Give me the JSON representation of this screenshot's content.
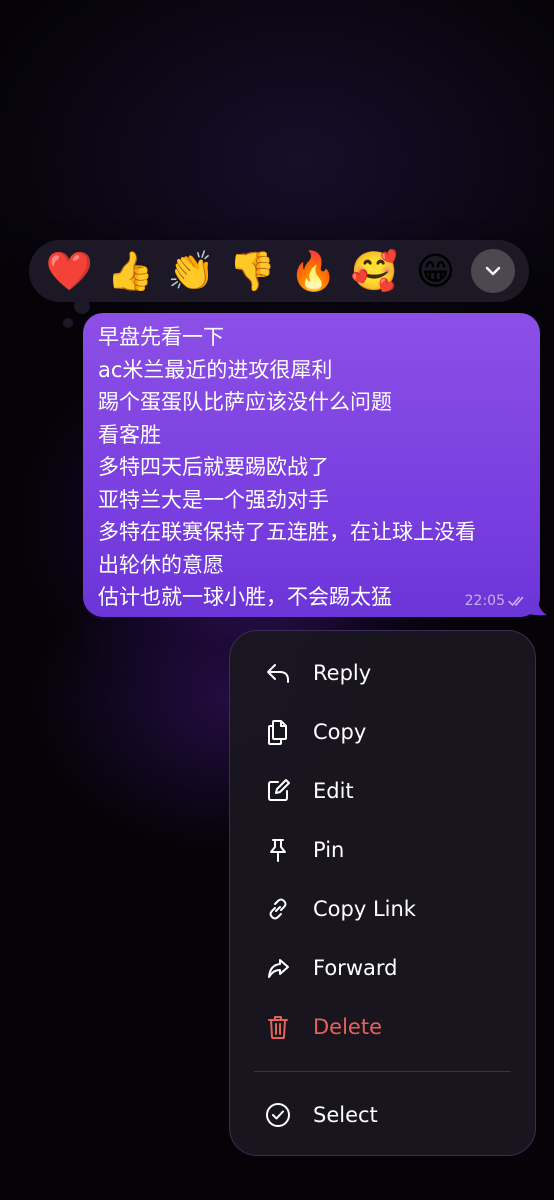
{
  "reactions": [
    {
      "emoji": "❤️",
      "name": "heart"
    },
    {
      "emoji": "👍",
      "name": "thumbs-up"
    },
    {
      "emoji": "👏",
      "name": "clapping-hands"
    },
    {
      "emoji": "👎",
      "name": "thumbs-down"
    },
    {
      "emoji": "🔥",
      "name": "fire"
    },
    {
      "emoji": "🥰",
      "name": "smiling-face-with-hearts"
    },
    {
      "emoji": "😁",
      "name": "grinning-face"
    }
  ],
  "reactions_more_icon": "chevron-down-icon",
  "message": {
    "lines": "早盘先看一下\nac米兰最近的进攻很犀利\n踢个蛋蛋队比萨应该没什么问题\n看客胜\n多特四天后就要踢欧战了\n亚特兰大是一个强劲对手\n多特在联赛保持了五连胜，在让球上没看\n出轮休的意愿\n估计也就一球小胜，不会踢太猛",
    "time": "22:05",
    "status_icon": "double-check-icon"
  },
  "menu": {
    "reply": "Reply",
    "copy": "Copy",
    "edit": "Edit",
    "pin": "Pin",
    "copy_link": "Copy Link",
    "forward": "Forward",
    "delete": "Delete",
    "select": "Select"
  },
  "colors": {
    "bubble": "#8c4fe6",
    "danger": "#e8605a",
    "menu_bg": "#1a1620"
  }
}
